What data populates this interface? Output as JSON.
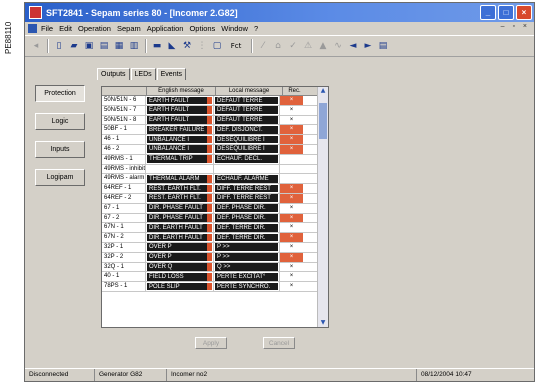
{
  "side_label": "PE88110",
  "window": {
    "title": "SFT2841 - Sepam series 80 - [Incomer 2.G82]"
  },
  "menu": [
    "File",
    "Edit",
    "Operation",
    "Sepam",
    "Application",
    "Options",
    "Window",
    "?"
  ],
  "toolbar": {
    "fct_label": "Fct"
  },
  "nav": [
    "Protection",
    "Logic",
    "Inputs",
    "Logipam"
  ],
  "tabs": [
    "Outputs",
    "LEDs",
    "Events"
  ],
  "grid": {
    "headers": [
      "",
      "English message",
      "Local message",
      "Rec."
    ],
    "rows": [
      {
        "code": "50N/51N - 6",
        "en": "EARTH FAULT",
        "local": "DEFAUT TERRE",
        "rec": "×",
        "on": true
      },
      {
        "code": "50N/51N - 7",
        "en": "EARTH FAULT",
        "local": "DEFAUT TERRE",
        "rec": "×",
        "on": false
      },
      {
        "code": "50N/51N - 8",
        "en": "EARTH FAULT",
        "local": "DEFAUT TERRE",
        "rec": "×",
        "on": false
      },
      {
        "code": "50BF - 1",
        "en": "BREAKER FAILURE",
        "local": "DEF. DISJONCT.",
        "rec": "×",
        "on": true
      },
      {
        "code": "46 - 1",
        "en": "UNBALANCE I",
        "local": "DESEQUILIBRE I",
        "rec": "×",
        "on": true
      },
      {
        "code": "46 - 2",
        "en": "UNBALANCE I",
        "local": "DESEQUILIBRE I",
        "rec": "×",
        "on": true
      },
      {
        "code": "49RMS - 1",
        "en": "THERMAL TRIP",
        "local": "ECHAUF. DECL.",
        "rec": "",
        "on": false
      },
      {
        "code": "49RMS - inhibit",
        "en": "",
        "local": "",
        "rec": "",
        "on": false
      },
      {
        "code": "49RMS - alarm",
        "en": "THERMAL ALARM",
        "local": "ECHAUF. ALARME",
        "rec": "",
        "on": false
      },
      {
        "code": "64REF - 1",
        "en": "REST. EARTH FLT.",
        "local": "DIFF. TERRE REST",
        "rec": "×",
        "on": true
      },
      {
        "code": "64REF - 2",
        "en": "REST. EARTH FLT.",
        "local": "DIFF. TERRE REST",
        "rec": "×",
        "on": true
      },
      {
        "code": "67 - 1",
        "en": "DIR. PHASE FAULT",
        "local": "DEF. PHASE DIR.",
        "rec": "×",
        "on": false
      },
      {
        "code": "67 - 2",
        "en": "DIR. PHASE FAULT",
        "local": "DEF. PHASE DIR.",
        "rec": "×",
        "on": true
      },
      {
        "code": "67N - 1",
        "en": "DIR. EARTH FAULT",
        "local": "DEF. TERRE DIR.",
        "rec": "×",
        "on": false
      },
      {
        "code": "67N - 2",
        "en": "DIR. EARTH FAULT",
        "local": "DEF. TERRE DIR.",
        "rec": "×",
        "on": true
      },
      {
        "code": "32P - 1",
        "en": "OVER P",
        "local": "P >>",
        "rec": "×",
        "on": false
      },
      {
        "code": "32P - 2",
        "en": "OVER P",
        "local": "P >>",
        "rec": "×",
        "on": true
      },
      {
        "code": "32Q - 1",
        "en": "OVER Q",
        "local": "Q >>",
        "rec": "×",
        "on": false
      },
      {
        "code": "40 - 1",
        "en": "FIELD LOSS",
        "local": "PERTE EXCITAT°",
        "rec": "×",
        "on": false
      },
      {
        "code": "78PS - 1",
        "en": "POLE SLIP",
        "local": "PERTE SYNCHRO.",
        "rec": "×",
        "on": false
      }
    ]
  },
  "buttons": {
    "apply": "Apply",
    "cancel": "Cancel"
  },
  "status": {
    "connection": "Disconnected",
    "generator": "Generator G82",
    "incomer": "Incomer no2",
    "datetime": "08/12/2004  10:47"
  }
}
